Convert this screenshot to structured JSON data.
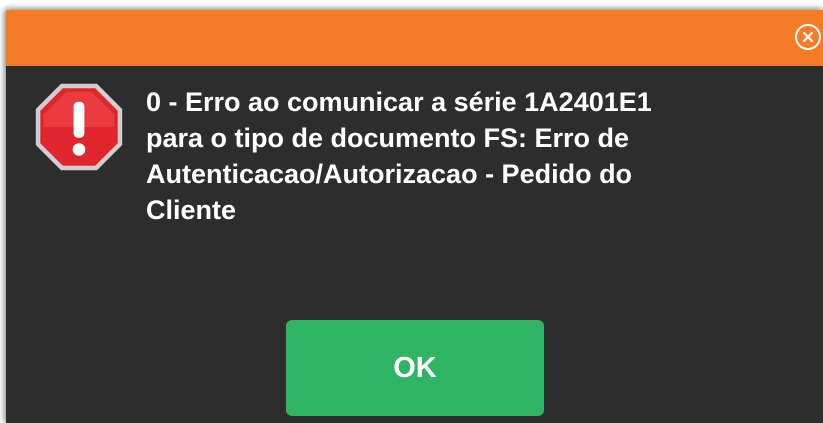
{
  "dialog": {
    "close_icon": "close-circle-icon",
    "alert_icon": "stop-sign-exclamation-icon",
    "message": "0 - Erro ao comunicar a série 1A2401E1\npara o tipo de documento FS: Erro de\nAutenticacao/Autorizacao - Pedido do\nCliente",
    "ok_label": "OK",
    "colors": {
      "titlebar": "#f47c27",
      "body": "#2d2d2d",
      "ok_button": "#2fb463",
      "alert_red": "#e0262c"
    }
  }
}
